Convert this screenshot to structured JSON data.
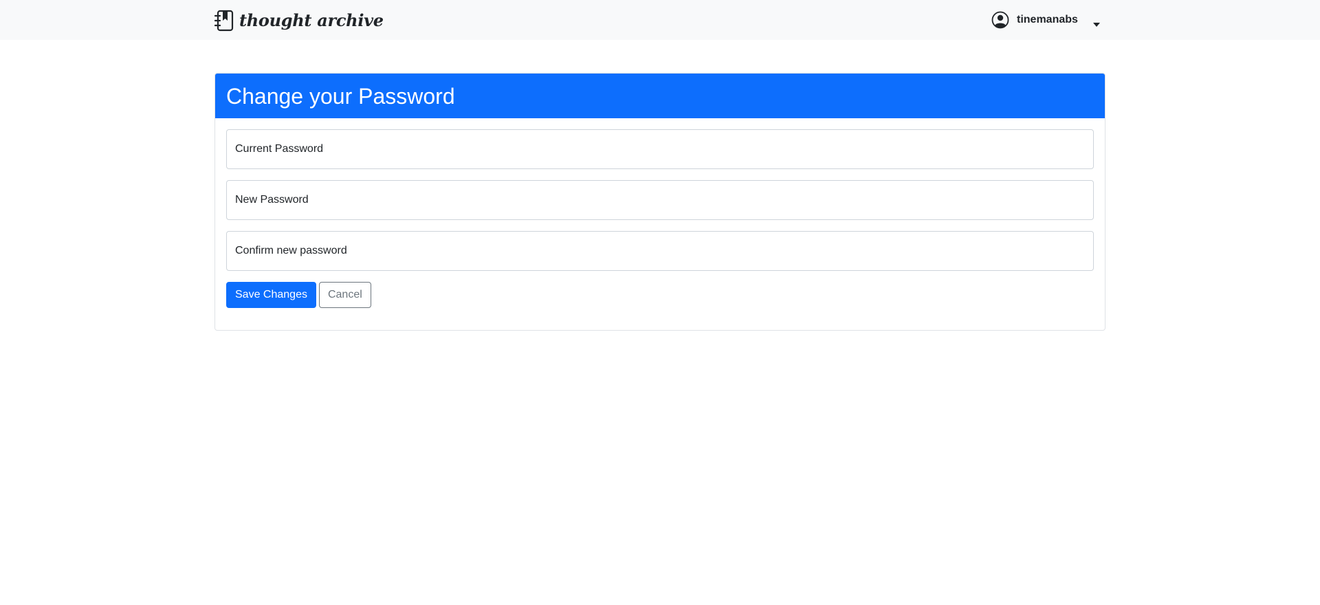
{
  "navbar": {
    "brand_icon": "journal-bookmark-icon",
    "brand_text": "thought archive",
    "user_icon": "person-circle-icon",
    "username": "tinemanabs",
    "dropdown_icon": "caret-down-icon"
  },
  "card": {
    "title": "Change your Password",
    "header_color": "#0d6efd",
    "fields": {
      "current_password": {
        "placeholder": "Current Password",
        "value": ""
      },
      "new_password": {
        "placeholder": "New Password",
        "value": ""
      },
      "confirm_password": {
        "placeholder": "Confirm new password",
        "value": ""
      }
    },
    "buttons": {
      "save": "Save Changes",
      "cancel": "Cancel"
    }
  },
  "colors": {
    "primary": "#0d6efd",
    "navbar_bg": "#f8f9fa",
    "secondary": "#6c757d"
  }
}
